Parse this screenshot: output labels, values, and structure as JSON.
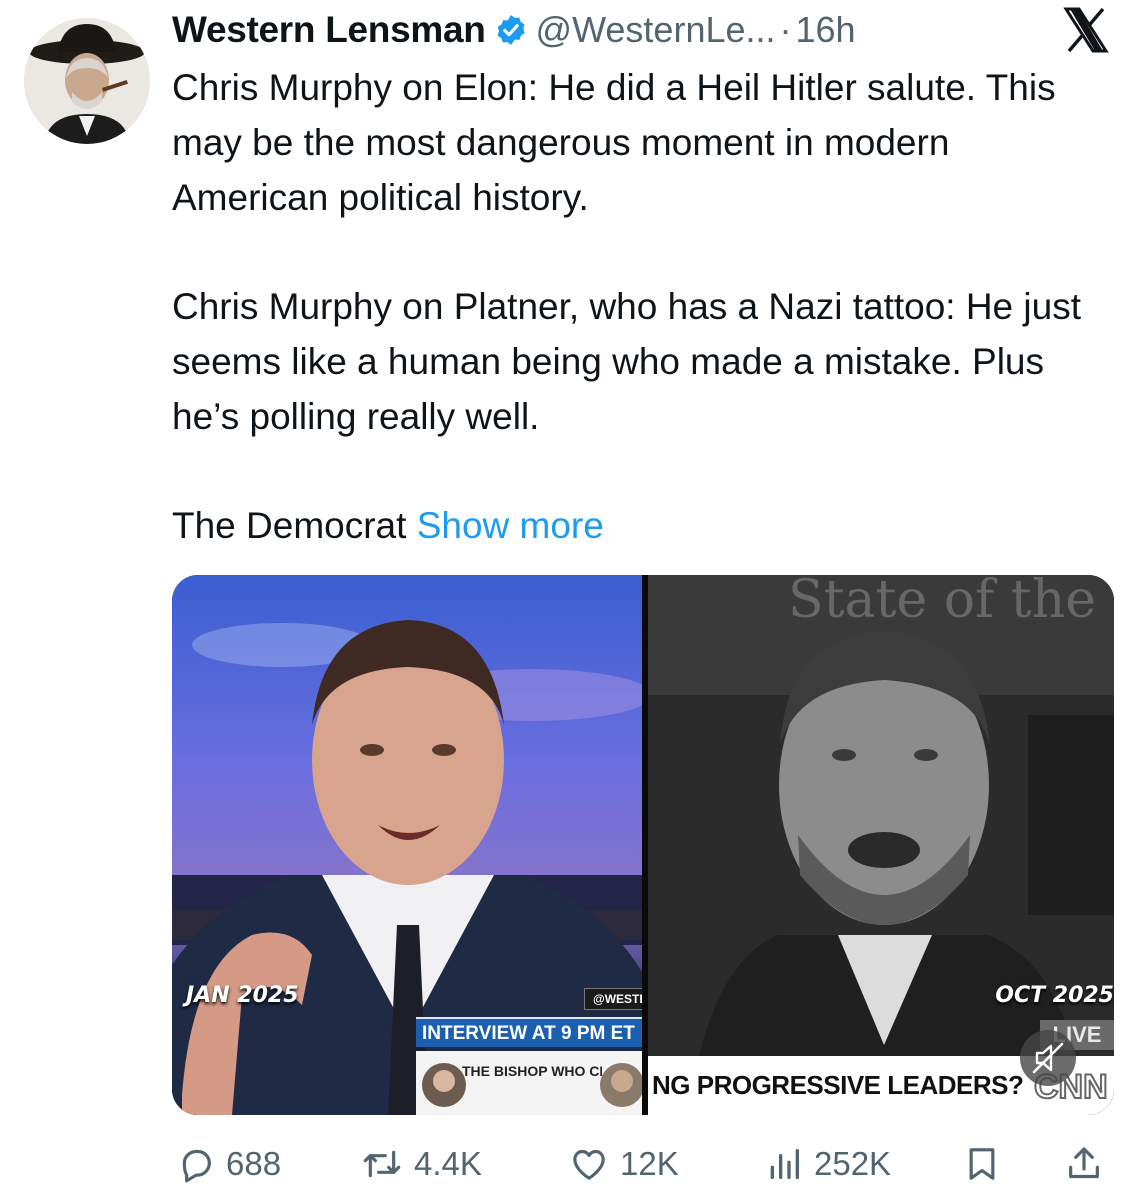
{
  "author": {
    "display_name": "Western Lensman",
    "handle": "@WesternLe...",
    "separator": "·",
    "time": "16h"
  },
  "tweet": {
    "paragraphs": [
      "Chris Murphy on Elon: He did a Heil Hitler salute. This may be the most dangerous moment in modern American political history.",
      "Chris Murphy on Platner, who has a Nazi tattoo: He just seems like a human being who made a mistake. Plus he’s polling really well."
    ],
    "truncated_text": "The Democrat",
    "show_more": "Show more"
  },
  "media": {
    "left_date": "JAN 2025",
    "right_date": "OCT 2025",
    "watermark": "@WESTERNLENSMAN",
    "interview_banner": "INTERVIEW AT 9 PM ET",
    "promo_text": "THE BISHOP WHO CHALLENGED PRES. TRUMP",
    "chyron": "NG PROGRESSIVE LEADERS?",
    "live_badge": "LIVE",
    "network_logo": "CNN",
    "studio_sign": "State of the",
    "studio_sign_small": "of the"
  },
  "actions": {
    "replies": "688",
    "reposts": "4.4K",
    "likes": "12K",
    "views": "252K"
  },
  "icons": {
    "verified": "verified-badge-icon",
    "brand": "x-logo-icon",
    "reply": "reply-icon",
    "repost": "repost-icon",
    "like": "heart-icon",
    "views": "views-icon",
    "bookmark": "bookmark-icon",
    "share": "share-icon",
    "mute": "muted-speaker-icon"
  },
  "colors": {
    "accent": "#1d9bf0",
    "text": "#0f1419",
    "secondary": "#536471"
  }
}
